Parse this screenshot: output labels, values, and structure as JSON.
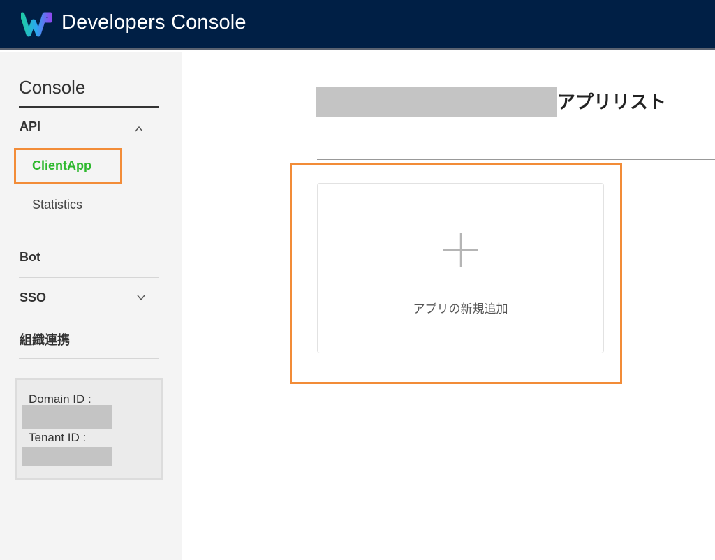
{
  "header": {
    "title": "Developers Console",
    "logo_icon": "works-logo-icon",
    "background": "#001f45"
  },
  "sidebar": {
    "console_title": "Console",
    "sections": {
      "api": {
        "label": "API",
        "expanded": true,
        "chevron_icon": "chevron-up-icon"
      },
      "bot": {
        "label": "Bot"
      },
      "sso": {
        "label": "SSO",
        "expanded": false,
        "chevron_icon": "chevron-down-icon"
      },
      "org": {
        "label": "組織連携"
      }
    },
    "api_items": {
      "client_app": {
        "label": "ClientApp",
        "active": true
      },
      "statistics": {
        "label": "Statistics"
      }
    },
    "info": {
      "domain_label": "Domain ID :",
      "tenant_label": "Tenant ID :"
    },
    "active_color": "#2eb82e"
  },
  "main": {
    "title_suffix": "アプリリスト",
    "add_card": {
      "label": "アプリの新規追加",
      "icon": "plus-icon"
    }
  },
  "annotations": {
    "highlight_color": "#f28c38"
  }
}
